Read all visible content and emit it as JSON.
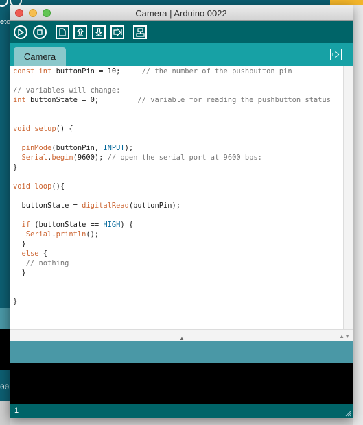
{
  "window": {
    "title": "Camera | Arduino 0022"
  },
  "toolbar": {
    "buttons": [
      {
        "name": "verify",
        "icon": "play-icon"
      },
      {
        "name": "stop",
        "icon": "stop-icon"
      },
      {
        "name": "new",
        "icon": "new-file-icon"
      },
      {
        "name": "open",
        "icon": "open-upload-icon"
      },
      {
        "name": "save",
        "icon": "save-download-icon"
      },
      {
        "name": "upload",
        "icon": "upload-arrow-icon"
      },
      {
        "name": "serial-monitor",
        "icon": "serial-monitor-icon"
      }
    ]
  },
  "tabs": [
    {
      "label": "Camera"
    }
  ],
  "background": {
    "left_number": "00",
    "left_text": "eto"
  },
  "editor": {
    "lines": [
      "const int buttonPin = 10;     // the number of the pushbutton pin",
      "",
      "// variables will change:",
      "int buttonState = 0;         // variable for reading the pushbutton status",
      "",
      "",
      "void setup() {",
      "",
      "  pinMode(buttonPin, INPUT);",
      "  Serial.begin(9600); // open the serial port at 9600 bps:",
      "}",
      "",
      "void loop(){",
      "",
      "  buttonState = digitalRead(buttonPin);",
      "",
      "  if (buttonState == HIGH) {",
      "   Serial.println();",
      "  }",
      "  else {",
      "   // nothing",
      "  }",
      "",
      "",
      "}"
    ]
  },
  "footer": {
    "line_number": "1"
  },
  "colors": {
    "toolbar": "#006468",
    "tabbar": "#17a1a5",
    "status": "#4a98a6",
    "keyword": "#cc6633",
    "constant": "#006699",
    "comment": "#777777"
  }
}
